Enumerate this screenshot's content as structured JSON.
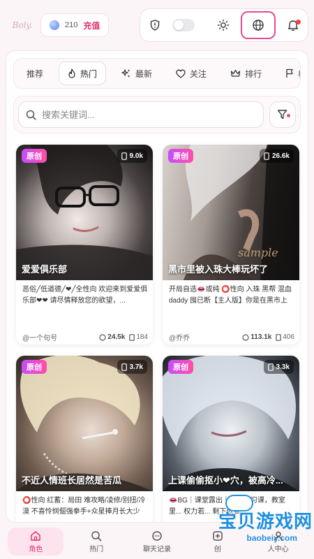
{
  "header": {
    "logo_text": "Boly.",
    "credits": "210",
    "recharge_label": "充值"
  },
  "tabs": [
    {
      "label": "推荐",
      "icon": "none"
    },
    {
      "label": "热门",
      "icon": "flame-icon",
      "active": true
    },
    {
      "label": "最新",
      "icon": "sparkle-icon"
    },
    {
      "label": "关注",
      "icon": "heart-icon"
    },
    {
      "label": "排行",
      "icon": "crown-icon"
    },
    {
      "label": "杯赛",
      "icon": "flag-icon"
    }
  ],
  "search": {
    "placeholder": "搜索关键词..."
  },
  "cards": [
    {
      "badge": "原创",
      "count": "9.0k",
      "title": "爱爱俱乐部",
      "desc": "恶俗╱低道德╱❤╱全性向 欢迎来到爱爱俱乐部❤❤ 请尽情释放您的欲望，...",
      "author": "@一个句号",
      "chats": "24.5k",
      "saves": "184"
    },
    {
      "badge": "原创",
      "count": "26.6k",
      "title": "黑市里被入珠大棒玩坏了",
      "desc": "开局自选👄或纯 ⭕性向 入珠 黑帮 混血 daddy 囤已断【主人版】你是在黑市上被...",
      "author": "@乔乔",
      "chats": "113.1k",
      "saves": "406"
    },
    {
      "badge": "原创",
      "count": "3.7k",
      "title": "不近人情班长居然是苦瓜",
      "desc": "⭕性向 红蓄：局田 难攻略/凌修/别扭/冷漠 不喜怜悯倔强拳手+众星捧月长大少爷...",
      "author": "",
      "chats": "",
      "saves": ""
    },
    {
      "badge": "原创",
      "count": "3.3k",
      "title": "上课偷偷抠小❤穴，被高冷...",
      "desc": "👄BG｜课堂露出｜高三自习课，教室里... 权力若... 剩下纸张...",
      "author": "",
      "chats": "",
      "saves": ""
    }
  ],
  "nav": [
    {
      "label": "角色",
      "icon": "home-icon",
      "active": true
    },
    {
      "label": "热门",
      "icon": "search-icon"
    },
    {
      "label": "聊天记录",
      "icon": "chat-icon"
    },
    {
      "label": "创",
      "icon": "create-icon"
    },
    {
      "label": "人中心",
      "icon": "user-icon"
    }
  ],
  "watermark": {
    "title": "宝贝游戏网",
    "url": "baobeiy.com"
  },
  "colors": {
    "accent": "#e2336f",
    "badge_from": "#c84bff",
    "badge_to": "#ff4fa5",
    "highlight_border": "#e24a94"
  }
}
